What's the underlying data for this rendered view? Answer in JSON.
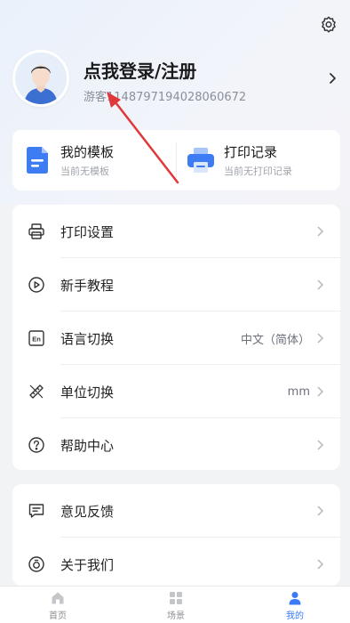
{
  "profile": {
    "login_title": "点我登录/注册",
    "guest_id": "游客1148797194028060672"
  },
  "quick": {
    "templates_title": "我的模板",
    "templates_sub": "当前无模板",
    "records_title": "打印记录",
    "records_sub": "当前无打印记录"
  },
  "menu": {
    "print_settings": "打印设置",
    "tutorial": "新手教程",
    "language": "语言切换",
    "language_value": "中文（简体）",
    "unit": "单位切换",
    "unit_value": "mm",
    "help": "帮助中心",
    "feedback": "意见反馈",
    "about": "关于我们"
  },
  "tabs": {
    "home": "首页",
    "scenes": "场景",
    "mine": "我的"
  },
  "colors": {
    "accent": "#3a7af5",
    "annotation_arrow": "#e0383b"
  },
  "icons": [
    "gear-icon",
    "avatar-icon",
    "chevron-right-icon",
    "template-doc-icon",
    "printer-icon",
    "print-settings-icon",
    "play-circle-icon",
    "language-en-icon",
    "ruler-icon",
    "help-circle-icon",
    "feedback-icon",
    "about-icon",
    "home-icon",
    "grid-icon",
    "person-icon"
  ]
}
